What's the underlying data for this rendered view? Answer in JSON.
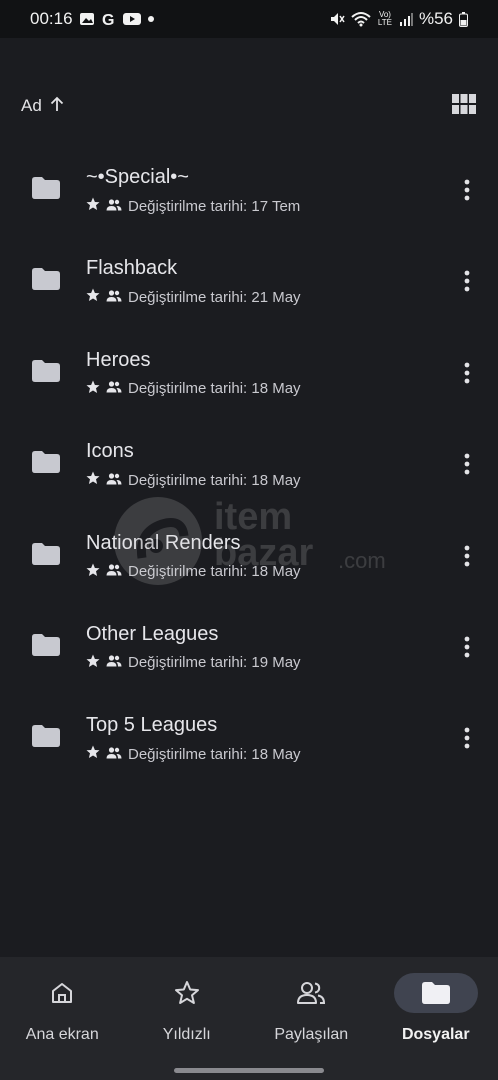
{
  "status_bar": {
    "time": "00:16",
    "left_icons": [
      "gallery-icon",
      "google-icon",
      "youtube-icon",
      "dot-icon"
    ],
    "right_icons": [
      "mute-icon",
      "wifi-icon",
      "volte-icon",
      "signal-icon",
      "battery-icon"
    ],
    "volte_text": "Vo) LTE",
    "battery": "%56"
  },
  "sort": {
    "label": "Ad",
    "direction": "ascending",
    "view_toggle": "grid-view-icon"
  },
  "files": [
    {
      "name": "~•Special•~",
      "meta": "Değiştirilme tarihi: 17 Tem"
    },
    {
      "name": "Flashback",
      "meta": "Değiştirilme tarihi: 21 May"
    },
    {
      "name": "Heroes",
      "meta": "Değiştirilme tarihi: 18 May"
    },
    {
      "name": "Icons",
      "meta": "Değiştirilme tarihi: 18 May"
    },
    {
      "name": "National Renders",
      "meta": "Değiştirilme tarihi: 18 May"
    },
    {
      "name": "Other Leagues",
      "meta": "Değiştirilme tarihi: 19 May"
    },
    {
      "name": "Top 5 Leagues",
      "meta": "Değiştirilme tarihi: 18 May"
    }
  ],
  "watermark": {
    "line1": "item",
    "line2": "bazar",
    "suffix": ".com"
  },
  "bottom_nav": [
    {
      "label": "Ana ekran",
      "icon": "home-icon",
      "active": false
    },
    {
      "label": "Yıldızlı",
      "icon": "star-icon",
      "active": false
    },
    {
      "label": "Paylaşılan",
      "icon": "people-icon",
      "active": false
    },
    {
      "label": "Dosyalar",
      "icon": "folder-icon",
      "active": true
    }
  ],
  "colors": {
    "background": "#1b1c20",
    "nav_background": "#25262a",
    "active_pill": "#404450",
    "text": "#e3e3e6"
  }
}
